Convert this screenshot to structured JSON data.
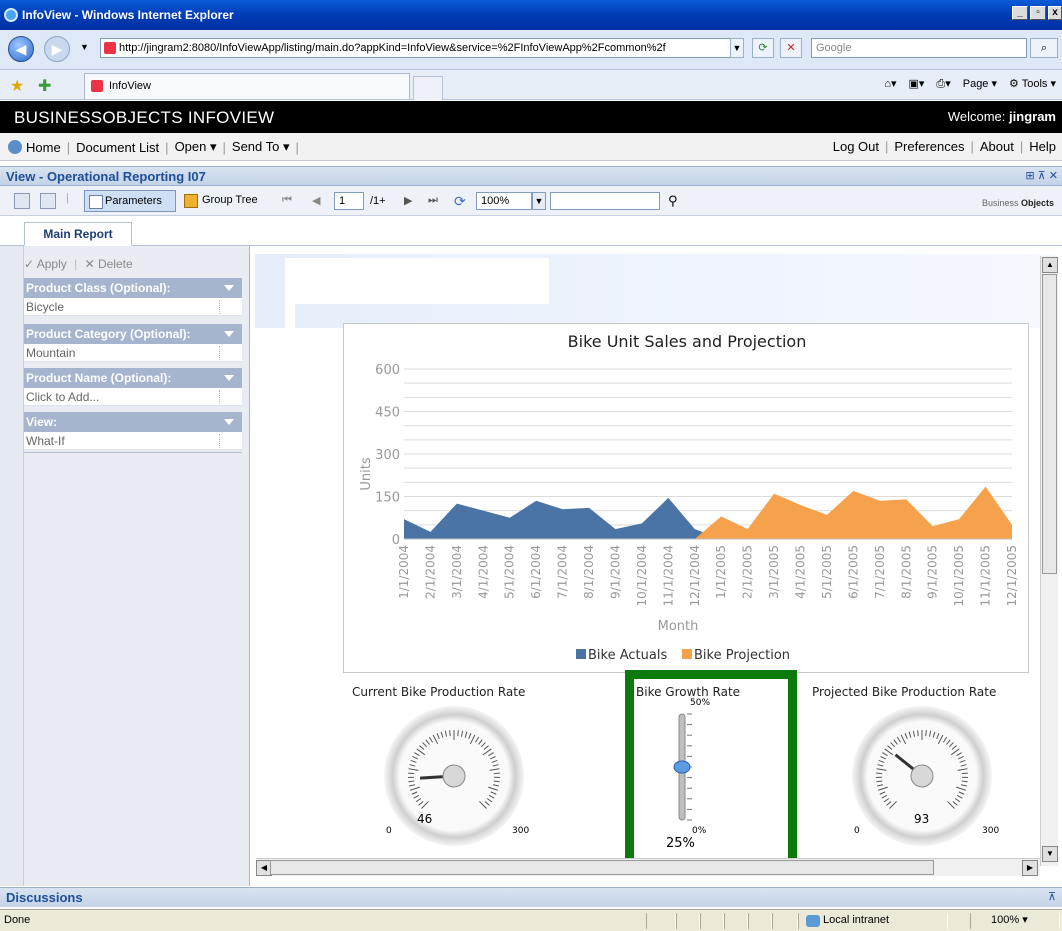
{
  "window": {
    "title": "InfoView - Windows Internet Explorer"
  },
  "browser": {
    "url": "http://jingram2:8080/InfoViewApp/listing/main.do?appKind=InfoView&service=%2FInfoViewApp%2Fcommon%2f",
    "search_placeholder": "Google",
    "tab_label": "InfoView",
    "commands": {
      "page": "Page",
      "tools": "Tools"
    }
  },
  "app": {
    "brand": "BUSINESSOBJECTS INFOVIEW",
    "welcome_label": "Welcome:",
    "user": "jingram",
    "menu_left": [
      "Home",
      "Document List",
      "Open",
      "Send To"
    ],
    "menu_right": [
      "Log Out",
      "Preferences",
      "About",
      "Help"
    ]
  },
  "view": {
    "title": "View - Operational Reporting I07",
    "toolbar": {
      "parameters": "Parameters",
      "group_tree": "Group Tree",
      "page_value": "1",
      "page_total": "/1+",
      "zoom": "100%",
      "logo_a": "Business",
      "logo_b": "Objects"
    },
    "tabs": [
      "Main Report"
    ]
  },
  "params": {
    "apply": "Apply",
    "delete": "Delete",
    "items": [
      {
        "label": "Product Class (Optional):",
        "value": "Bicycle"
      },
      {
        "label": "Product Category (Optional):",
        "value": "Mountain"
      },
      {
        "label": "Product Name (Optional):",
        "value": "Click to Add..."
      },
      {
        "label": "View:",
        "value": "What-If"
      }
    ]
  },
  "chart_data": {
    "type": "area",
    "title": "Bike Unit Sales and Projection",
    "xlabel": "Month",
    "ylabel": "Units",
    "ylim": [
      0,
      600
    ],
    "yticks": [
      0,
      150,
      300,
      450,
      600
    ],
    "categories": [
      "1/1/2004",
      "2/1/2004",
      "3/1/2004",
      "4/1/2004",
      "5/1/2004",
      "6/1/2004",
      "7/1/2004",
      "8/1/2004",
      "9/1/2004",
      "10/1/2004",
      "11/1/2004",
      "12/1/2004",
      "1/1/2005",
      "2/1/2005",
      "3/1/2005",
      "4/1/2005",
      "5/1/2005",
      "6/1/2005",
      "7/1/2005",
      "8/1/2005",
      "9/1/2005",
      "10/1/2005",
      "11/1/2005",
      "12/1/2005"
    ],
    "series": [
      {
        "name": "Bike Actuals",
        "color": "#4a74a6",
        "values": [
          70,
          25,
          125,
          100,
          75,
          135,
          105,
          110,
          35,
          55,
          145,
          35,
          0,
          null,
          null,
          null,
          null,
          null,
          null,
          null,
          null,
          null,
          null,
          null
        ]
      },
      {
        "name": "Bike Projection",
        "color": "#f6a24c",
        "values": [
          null,
          null,
          null,
          null,
          null,
          null,
          null,
          null,
          null,
          null,
          null,
          0,
          80,
          35,
          160,
          120,
          85,
          170,
          135,
          140,
          45,
          70,
          185,
          50
        ]
      }
    ],
    "legend": "bottom",
    "grid": true
  },
  "gauges": [
    {
      "title": "Current Bike Production Rate",
      "value": "46",
      "min": "0",
      "max": "300",
      "reading": 46
    },
    {
      "title": "Bike Growth Rate",
      "value": "25%",
      "min": "0%",
      "max": "50%",
      "reading": 25
    },
    {
      "title": "Projected Bike Production Rate",
      "value": "93",
      "min": "0",
      "max": "300",
      "reading": 93
    }
  ],
  "bottom": {
    "discussions": "Discussions",
    "status": "Done",
    "zone": "Local intranet",
    "zoom": "100%"
  }
}
